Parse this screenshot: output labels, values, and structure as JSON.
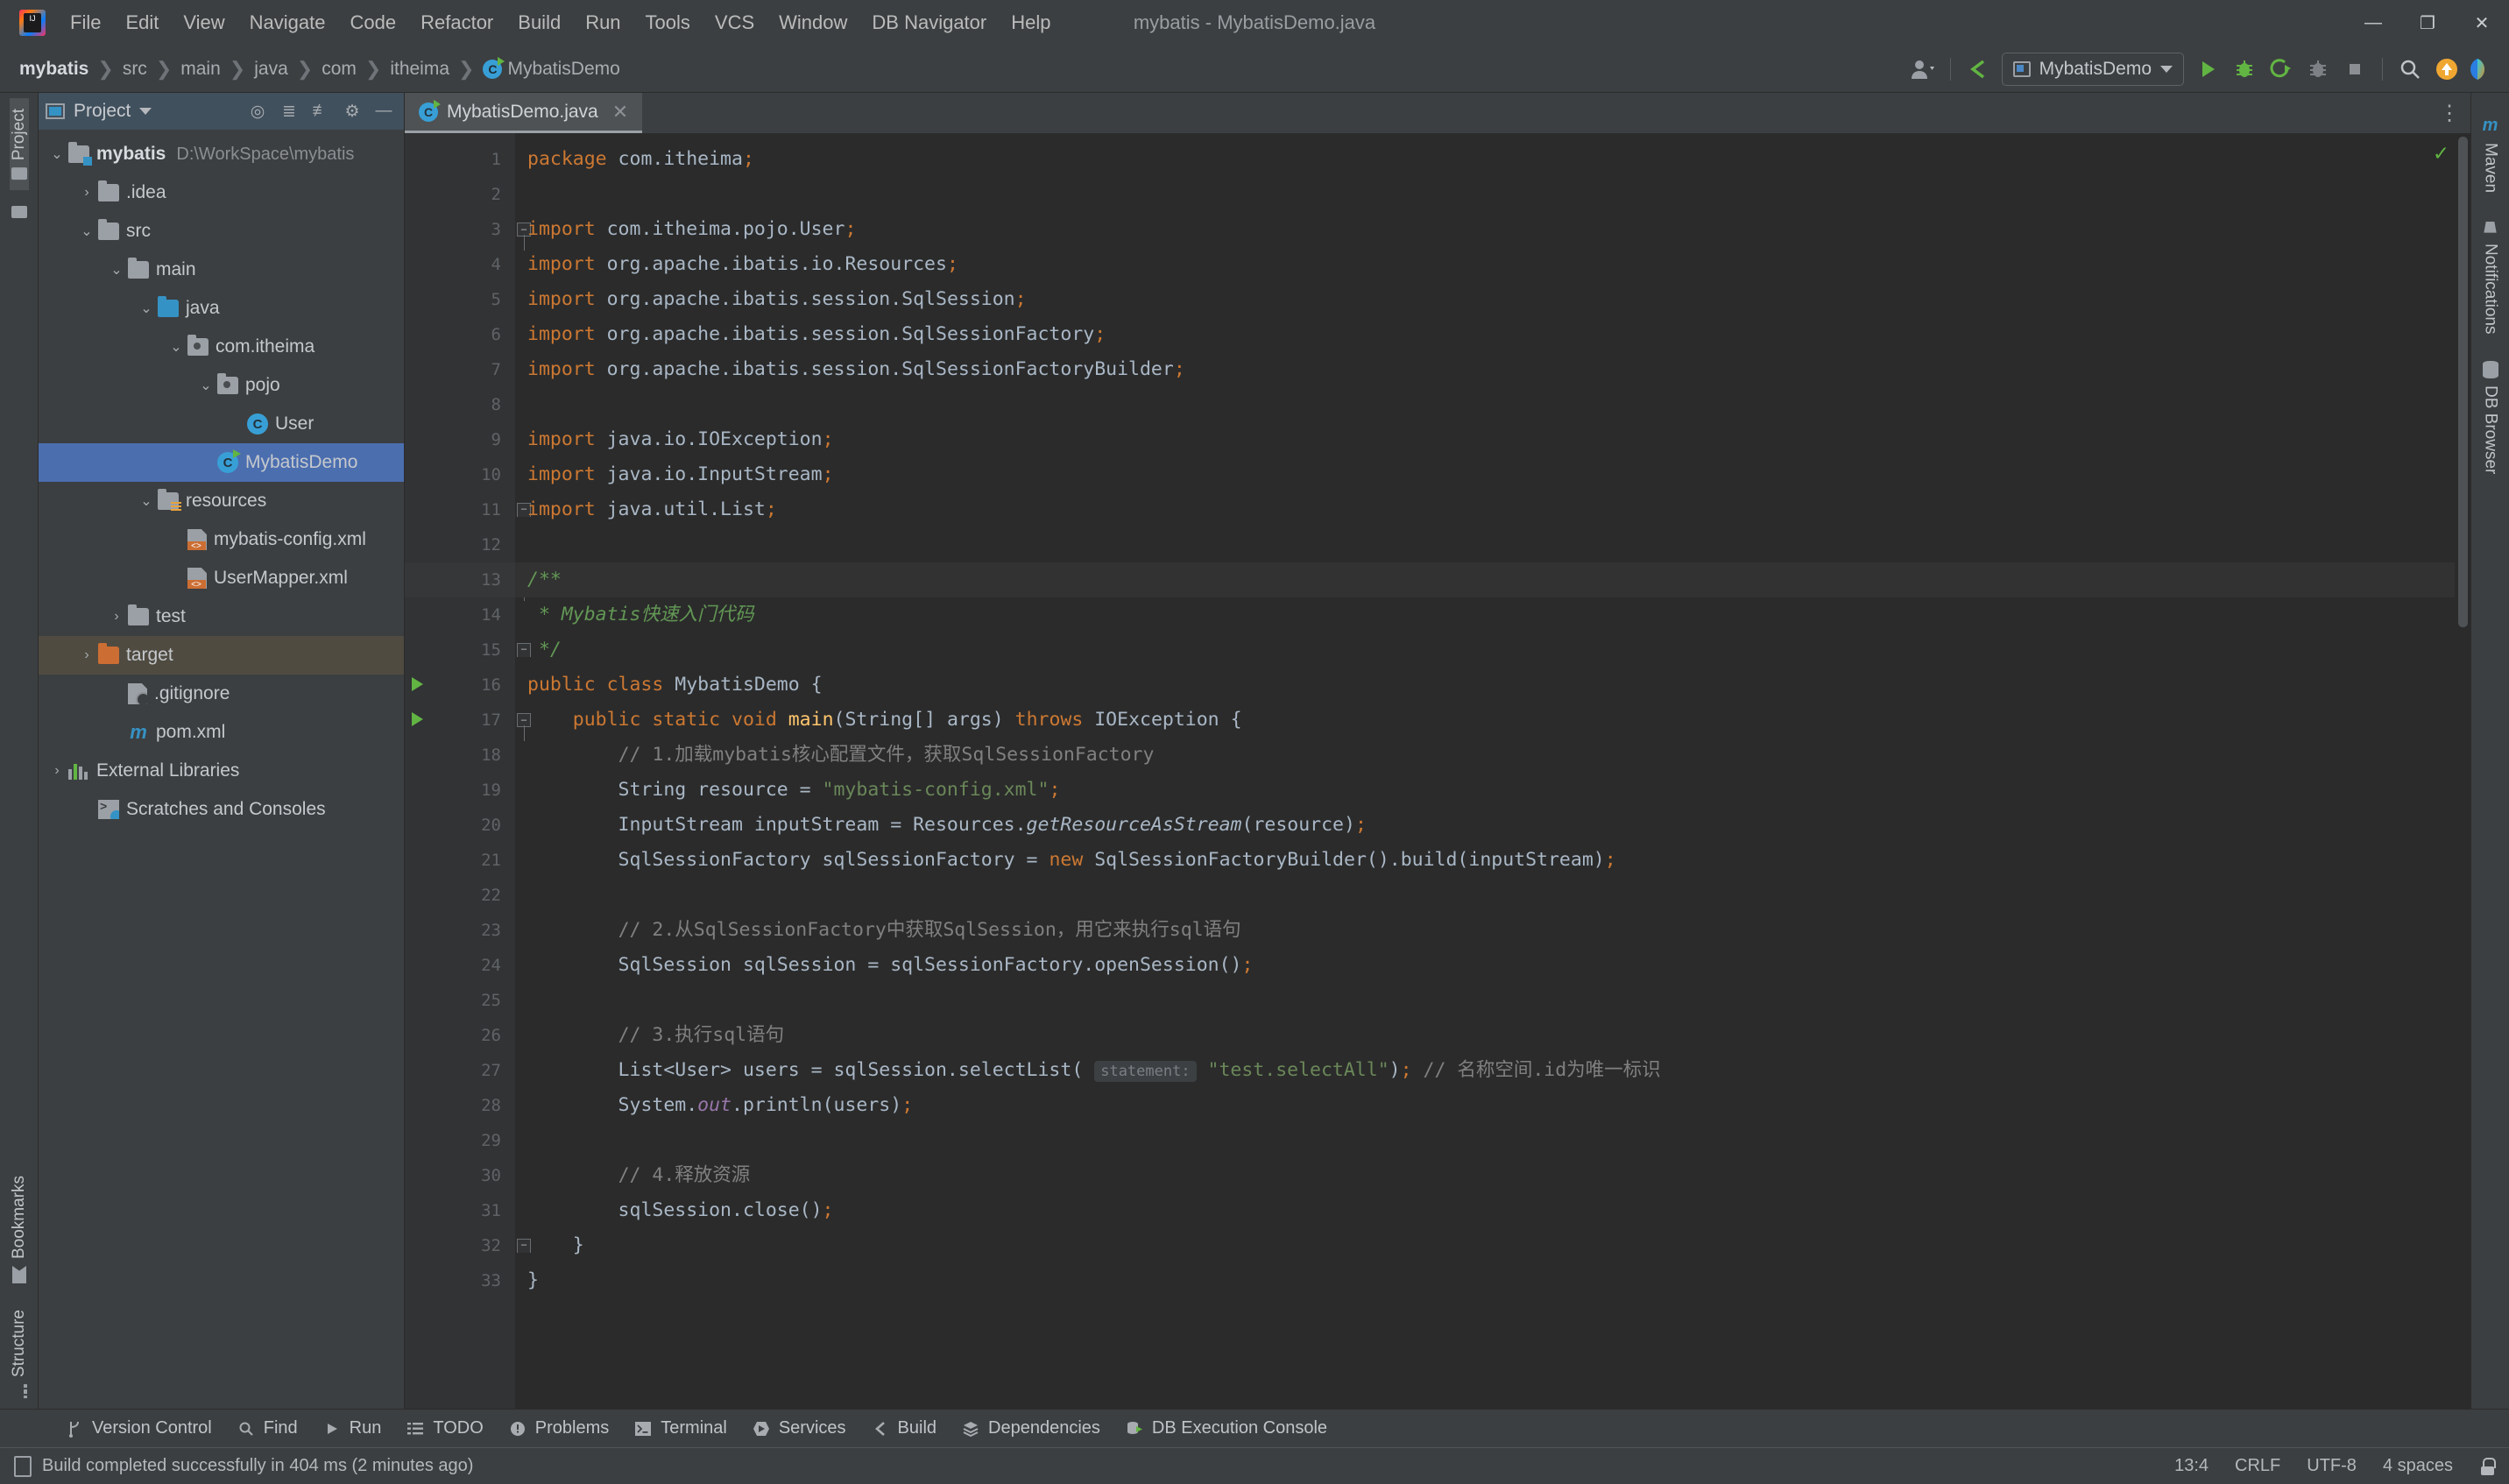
{
  "window": {
    "title": "mybatis - MybatisDemo.java",
    "logo_text": "IJ",
    "minimize": "—",
    "maximize": "❐",
    "close": "✕"
  },
  "menu": [
    {
      "label": "File"
    },
    {
      "label": "Edit"
    },
    {
      "label": "View"
    },
    {
      "label": "Navigate"
    },
    {
      "label": "Code"
    },
    {
      "label": "Refactor"
    },
    {
      "label": "Build"
    },
    {
      "label": "Run"
    },
    {
      "label": "Tools"
    },
    {
      "label": "VCS"
    },
    {
      "label": "Window"
    },
    {
      "label": "DB Navigator"
    },
    {
      "label": "Help"
    }
  ],
  "breadcrumbs": [
    {
      "label": "mybatis",
      "bold": true
    },
    {
      "label": "src"
    },
    {
      "label": "main"
    },
    {
      "label": "java"
    },
    {
      "label": "com"
    },
    {
      "label": "itheima"
    },
    {
      "label": "MybatisDemo",
      "icon": "java-class-icon"
    }
  ],
  "toolbar": {
    "run_config": "MybatisDemo",
    "icons": [
      "user-account-icon",
      "update-project-icon",
      "run-icon",
      "debug-icon",
      "run-with-coverage-icon",
      "profile-icon",
      "stop-icon",
      "search-everywhere-icon",
      "ide-update-icon",
      "ai-assistant-icon"
    ]
  },
  "left_rail": [
    {
      "label": "Project",
      "icon": "project-icon",
      "active": true
    },
    {
      "label": "Bookmarks",
      "icon": "bookmarks-icon",
      "active": false
    },
    {
      "label": "Structure",
      "icon": "structure-icon",
      "active": false
    }
  ],
  "right_rail": [
    {
      "label": "Maven",
      "icon": "maven-icon"
    },
    {
      "label": "Notifications",
      "icon": "bell-icon"
    },
    {
      "label": "DB Browser",
      "icon": "db-browser-icon"
    }
  ],
  "project_panel": {
    "title": "Project",
    "header_icons": [
      "locate-icon",
      "expand-all-icon",
      "collapse-all-icon",
      "settings-icon",
      "hide-icon"
    ],
    "tree": [
      {
        "label": "mybatis",
        "path": "D:\\WorkSpace\\mybatis",
        "arrow": "⌄",
        "icon": "module-folder-icon",
        "indent": 0,
        "bold": true,
        "state": "normal"
      },
      {
        "label": ".idea",
        "path": "",
        "arrow": "›",
        "icon": "folder-icon",
        "indent": 1,
        "bold": false,
        "state": "normal"
      },
      {
        "label": "src",
        "path": "",
        "arrow": "⌄",
        "icon": "folder-icon",
        "indent": 1,
        "bold": false,
        "state": "normal"
      },
      {
        "label": "main",
        "path": "",
        "arrow": "⌄",
        "icon": "folder-icon",
        "indent": 2,
        "bold": false,
        "state": "normal"
      },
      {
        "label": "java",
        "path": "",
        "arrow": "⌄",
        "icon": "source-folder-icon",
        "indent": 3,
        "bold": false,
        "state": "normal"
      },
      {
        "label": "com.itheima",
        "path": "",
        "arrow": "⌄",
        "icon": "package-icon",
        "indent": 4,
        "bold": false,
        "state": "normal"
      },
      {
        "label": "pojo",
        "path": "",
        "arrow": "⌄",
        "icon": "package-icon",
        "indent": 5,
        "bold": false,
        "state": "normal"
      },
      {
        "label": "User",
        "path": "",
        "arrow": "",
        "icon": "java-class-icon",
        "indent": 6,
        "bold": false,
        "state": "normal"
      },
      {
        "label": "MybatisDemo",
        "path": "",
        "arrow": "",
        "icon": "java-runnable-class-icon",
        "indent": 5,
        "bold": false,
        "state": "selected"
      },
      {
        "label": "resources",
        "path": "",
        "arrow": "⌄",
        "icon": "resources-folder-icon",
        "indent": 3,
        "bold": false,
        "state": "normal"
      },
      {
        "label": "mybatis-config.xml",
        "path": "",
        "arrow": "",
        "icon": "xml-file-icon",
        "indent": 4,
        "bold": false,
        "state": "normal"
      },
      {
        "label": "UserMapper.xml",
        "path": "",
        "arrow": "",
        "icon": "xml-file-icon",
        "indent": 4,
        "bold": false,
        "state": "normal"
      },
      {
        "label": "test",
        "path": "",
        "arrow": "›",
        "icon": "folder-icon",
        "indent": 2,
        "bold": false,
        "state": "normal"
      },
      {
        "label": "target",
        "path": "",
        "arrow": "›",
        "icon": "excluded-folder-icon",
        "indent": 1,
        "bold": false,
        "state": "highlight"
      },
      {
        "label": ".gitignore",
        "path": "",
        "arrow": "",
        "icon": "gitignore-file-icon",
        "indent": 2,
        "bold": false,
        "state": "normal"
      },
      {
        "label": "pom.xml",
        "path": "",
        "arrow": "",
        "icon": "maven-pom-icon",
        "indent": 2,
        "bold": false,
        "state": "normal"
      },
      {
        "label": "External Libraries",
        "path": "",
        "arrow": "›",
        "icon": "libraries-icon",
        "indent": 0,
        "bold": false,
        "state": "normal"
      },
      {
        "label": "Scratches and Consoles",
        "path": "",
        "arrow": "",
        "icon": "scratches-icon",
        "indent": 0,
        "bold": false,
        "state": "normal"
      }
    ]
  },
  "editor": {
    "tab": {
      "label": "MybatisDemo.java",
      "close": "✕",
      "icon": "java-runnable-class-icon"
    },
    "inspection_status": "✓",
    "lines": [
      {
        "n": 1,
        "runmark": false,
        "fold": "",
        "current": false
      },
      {
        "n": 2,
        "runmark": false,
        "fold": "",
        "current": false
      },
      {
        "n": 3,
        "runmark": false,
        "fold": "start",
        "current": false
      },
      {
        "n": 4,
        "runmark": false,
        "fold": "",
        "current": false
      },
      {
        "n": 5,
        "runmark": false,
        "fold": "",
        "current": false
      },
      {
        "n": 6,
        "runmark": false,
        "fold": "",
        "current": false
      },
      {
        "n": 7,
        "runmark": false,
        "fold": "",
        "current": false
      },
      {
        "n": 8,
        "runmark": false,
        "fold": "",
        "current": false
      },
      {
        "n": 9,
        "runmark": false,
        "fold": "",
        "current": false
      },
      {
        "n": 10,
        "runmark": false,
        "fold": "",
        "current": false
      },
      {
        "n": 11,
        "runmark": false,
        "fold": "end",
        "current": false
      },
      {
        "n": 12,
        "runmark": false,
        "fold": "",
        "current": false
      },
      {
        "n": 13,
        "runmark": false,
        "fold": "start",
        "current": true
      },
      {
        "n": 14,
        "runmark": false,
        "fold": "",
        "current": false
      },
      {
        "n": 15,
        "runmark": false,
        "fold": "end",
        "current": false
      },
      {
        "n": 16,
        "runmark": true,
        "fold": "",
        "current": false
      },
      {
        "n": 17,
        "runmark": true,
        "fold": "start",
        "current": false
      },
      {
        "n": 18,
        "runmark": false,
        "fold": "",
        "current": false
      },
      {
        "n": 19,
        "runmark": false,
        "fold": "",
        "current": false
      },
      {
        "n": 20,
        "runmark": false,
        "fold": "",
        "current": false
      },
      {
        "n": 21,
        "runmark": false,
        "fold": "",
        "current": false
      },
      {
        "n": 22,
        "runmark": false,
        "fold": "",
        "current": false
      },
      {
        "n": 23,
        "runmark": false,
        "fold": "",
        "current": false
      },
      {
        "n": 24,
        "runmark": false,
        "fold": "",
        "current": false
      },
      {
        "n": 25,
        "runmark": false,
        "fold": "",
        "current": false
      },
      {
        "n": 26,
        "runmark": false,
        "fold": "",
        "current": false
      },
      {
        "n": 27,
        "runmark": false,
        "fold": "",
        "current": false
      },
      {
        "n": 28,
        "runmark": false,
        "fold": "",
        "current": false
      },
      {
        "n": 29,
        "runmark": false,
        "fold": "",
        "current": false
      },
      {
        "n": 30,
        "runmark": false,
        "fold": "",
        "current": false
      },
      {
        "n": 31,
        "runmark": false,
        "fold": "",
        "current": false
      },
      {
        "n": 32,
        "runmark": false,
        "fold": "end",
        "current": false
      },
      {
        "n": 33,
        "runmark": false,
        "fold": "",
        "current": false
      }
    ],
    "code": [
      "package com.itheima;",
      "",
      "import com.itheima.pojo.User;",
      "import org.apache.ibatis.io.Resources;",
      "import org.apache.ibatis.session.SqlSession;",
      "import org.apache.ibatis.session.SqlSessionFactory;",
      "import org.apache.ibatis.session.SqlSessionFactoryBuilder;",
      "",
      "import java.io.IOException;",
      "import java.io.InputStream;",
      "import java.util.List;",
      "",
      "/**",
      " * Mybatis快速入门代码",
      " */",
      "public class MybatisDemo {",
      "    public static void main(String[] args) throws IOException {",
      "        // 1.加载mybatis核心配置文件，获取SqlSessionFactory",
      "        String resource = \"mybatis-config.xml\";",
      "        InputStream inputStream = Resources.getResourceAsStream(resource);",
      "        SqlSessionFactory sqlSessionFactory = new SqlSessionFactoryBuilder().build(inputStream);",
      "",
      "        // 2.从SqlSessionFactory中获取SqlSession，用它来执行sql语句",
      "        SqlSession sqlSession = sqlSessionFactory.openSession();",
      "",
      "        // 3.执行sql语句",
      "        List<User> users = sqlSession.selectList( statement: \"test.selectAll\"); // 名称空间.id为唯一标识",
      "        System.out.println(users);",
      "",
      "        // 4.释放资源",
      "        sqlSession.close();",
      "    }",
      "}"
    ],
    "parameter_hint": "statement:"
  },
  "tool_windows": [
    {
      "label": "Version Control",
      "icon": "branch-icon"
    },
    {
      "label": "Find",
      "icon": "search-icon"
    },
    {
      "label": "Run",
      "icon": "run-icon"
    },
    {
      "label": "TODO",
      "icon": "todo-list-icon"
    },
    {
      "label": "Problems",
      "icon": "problems-icon"
    },
    {
      "label": "Terminal",
      "icon": "terminal-icon"
    },
    {
      "label": "Services",
      "icon": "services-icon"
    },
    {
      "label": "Build",
      "icon": "build-hammer-icon"
    },
    {
      "label": "Dependencies",
      "icon": "dependencies-icon"
    },
    {
      "label": "DB Execution Console",
      "icon": "db-console-icon"
    }
  ],
  "status_bar": {
    "message": "Build completed successfully in 404 ms (2 minutes ago)",
    "caret": "13:4",
    "line_separator": "CRLF",
    "encoding": "UTF-8",
    "indent": "4 spaces",
    "lock_icon": "unlocked-icon"
  },
  "colors": {
    "bg_chrome": "#3c3f41",
    "bg_editor": "#2b2b2b",
    "selection": "#4b6eaf",
    "accent_green": "#62b543",
    "accent_blue": "#3592c4",
    "keyword": "#cc7832",
    "string": "#6a8759",
    "comment": "#808080",
    "doc_comment": "#629755",
    "method": "#ffc66d"
  }
}
